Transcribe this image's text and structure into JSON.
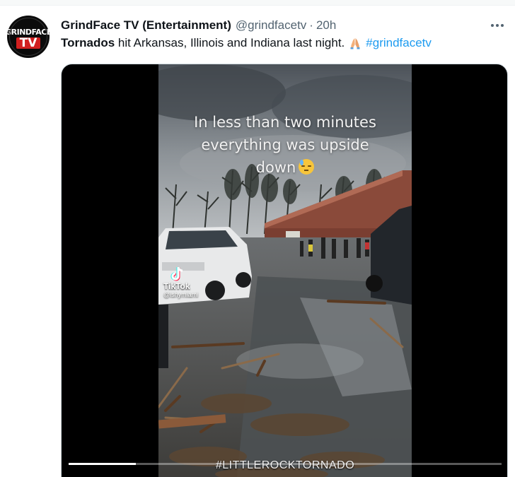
{
  "tweet": {
    "author_name": "GrindFace TV (Entertainment)",
    "author_handle": "@grindfacetv",
    "separator": "·",
    "time": "20h",
    "avatar": {
      "line1": "GRINDFACE",
      "line2": "TV"
    },
    "text": {
      "bold_word": "Tornados",
      "rest": " hit Arkansas, Illinois and Indiana last night.",
      "emoji": "folded-hands-icon",
      "hashtag": "#grindfacetv"
    }
  },
  "video": {
    "caption_lines": [
      "In less than two minutes",
      "everything was upside",
      "down"
    ],
    "caption_emoji": "sad-sweat-face-icon",
    "watermark_brand": "TikTok",
    "watermark_user": "@ishymiami",
    "hashtag_overlay": "#LITTLEROCKTORNADO",
    "progress": 0.155
  },
  "colors": {
    "accent": "#1d9bf0",
    "text": "#0f1419",
    "secondary": "#536471",
    "avatar_red": "#d11f1f"
  }
}
